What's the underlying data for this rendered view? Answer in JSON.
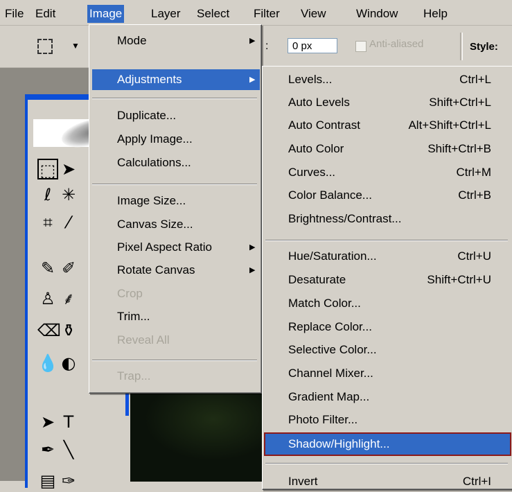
{
  "menubar": {
    "items": [
      "File",
      "Edit",
      "Image",
      "Layer",
      "Select",
      "Filter",
      "View",
      "Window",
      "Help"
    ],
    "active": "Image"
  },
  "options_bar": {
    "px_value": "0 px",
    "anti_aliased_label": "Anti-aliased",
    "style_label": "Style:"
  },
  "image_menu": {
    "mode": "Mode",
    "adjustments": "Adjustments",
    "duplicate": "Duplicate...",
    "apply_image": "Apply Image...",
    "calculations": "Calculations...",
    "image_size": "Image Size...",
    "canvas_size": "Canvas Size...",
    "pixel_aspect_ratio": "Pixel Aspect Ratio",
    "rotate_canvas": "Rotate Canvas",
    "crop": "Crop",
    "trim": "Trim...",
    "reveal_all": "Reveal All",
    "trap": "Trap..."
  },
  "adjustments_menu": {
    "items": [
      {
        "label": "Levels...",
        "shortcut": "Ctrl+L"
      },
      {
        "label": "Auto Levels",
        "shortcut": "Shift+Ctrl+L"
      },
      {
        "label": "Auto Contrast",
        "shortcut": "Alt+Shift+Ctrl+L"
      },
      {
        "label": "Auto Color",
        "shortcut": "Shift+Ctrl+B"
      },
      {
        "label": "Curves...",
        "shortcut": "Ctrl+M"
      },
      {
        "label": "Color Balance...",
        "shortcut": "Ctrl+B"
      },
      {
        "label": "Brightness/Contrast...",
        "shortcut": ""
      },
      {
        "label": "Hue/Saturation...",
        "shortcut": "Ctrl+U"
      },
      {
        "label": "Desaturate",
        "shortcut": "Shift+Ctrl+U"
      },
      {
        "label": "Match Color...",
        "shortcut": ""
      },
      {
        "label": "Replace Color...",
        "shortcut": ""
      },
      {
        "label": "Selective Color...",
        "shortcut": ""
      },
      {
        "label": "Channel Mixer...",
        "shortcut": ""
      },
      {
        "label": "Gradient Map...",
        "shortcut": ""
      },
      {
        "label": "Photo Filter...",
        "shortcut": ""
      },
      {
        "label": "Shadow/Highlight...",
        "shortcut": ""
      },
      {
        "label": "Invert",
        "shortcut": "Ctrl+I"
      }
    ]
  },
  "colors": {
    "menu_bg": "#d4d0c8",
    "highlight": "#316ac5",
    "disabled_text": "#a8a59b",
    "toolbox_border": "#0a4ed8"
  }
}
